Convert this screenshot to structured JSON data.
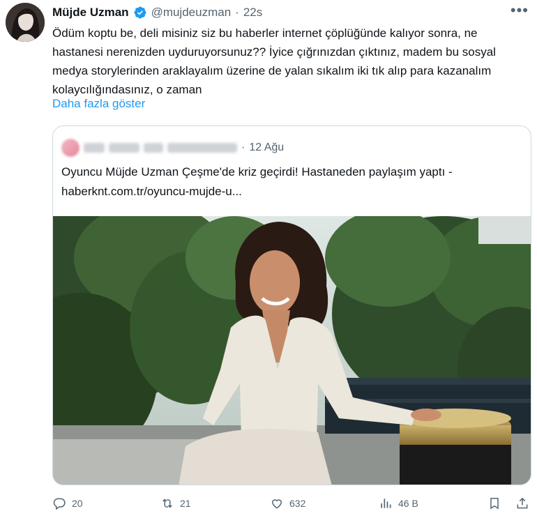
{
  "author": {
    "name": "Müjde Uzman",
    "handle": "@mujdeuzman",
    "separator": "·",
    "time": "22s"
  },
  "tweet": {
    "text": "Ödüm koptu be, deli misiniz siz bu haberler internet çöplüğünde kalıyor sonra, ne hastanesi nerenizden uyduruyorsunuz?? İyice çığrınızdan çıktınız, madem bu sosyal medya storylerinden araklayalım üzerine de yalan sıkalım iki tık alıp para kazanalım kolaycılığındasınız, o zaman",
    "show_more": "Daha fazla göster"
  },
  "quote": {
    "separator": "·",
    "time": "12 Ağu",
    "text": "Oyuncu Müjde Uzman Çeşme'de kriz geçirdi! Hastaneden paylaşım yaptı -  haberknt.com.tr/oyuncu-mujde-u..."
  },
  "actions": {
    "replies": "20",
    "retweets": "21",
    "likes": "632",
    "views": "46 B"
  },
  "icons": [
    "verified-badge-icon",
    "more-icon",
    "reply-icon",
    "retweet-icon",
    "like-icon",
    "views-icon",
    "bookmark-icon",
    "share-icon"
  ],
  "colors": {
    "accent": "#1d9bf0",
    "text": "#0f1419",
    "muted": "#536471",
    "border": "#cfd9de"
  }
}
